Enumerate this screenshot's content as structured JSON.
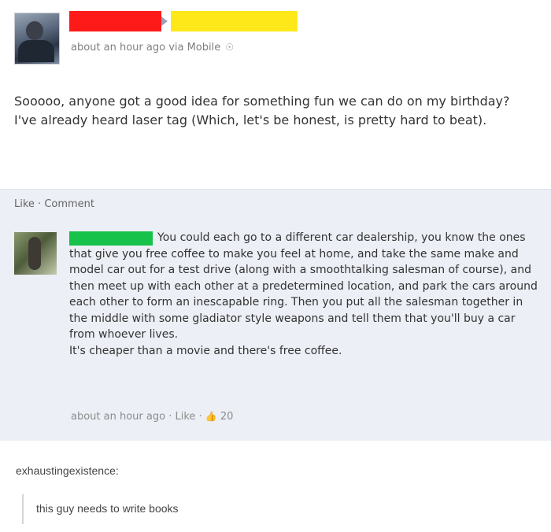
{
  "post": {
    "timestamp": "about an hour ago via Mobile",
    "mobile_icon": "mobile-icon",
    "text": "Sooooo, anyone got a good idea for something fun we can do on my birthday? I've already heard laser tag (Which, let's be honest, is pretty hard to beat).",
    "like_label": "Like",
    "separator": " · ",
    "comment_label": "Comment"
  },
  "redaction_colors": {
    "poster_name": "#ff1a1a",
    "tagged_name": "#ffe81a",
    "commenter_name": "#16c24a"
  },
  "comment": {
    "text": "You could each go to a different car dealership, you know the ones that give you free coffee to make you feel at home, and take the same make and model car out for a test drive (along with a smoothtalking salesman of course), and then meet up with each other at a predetermined location, and park the cars around each other to form an inescapable ring. Then you put all the salesman together in the middle with some gladiator style weapons and tell them that you'll buy a car from whoever lives.",
    "text2": "It's cheaper than a movie and there's free coffee.",
    "timestamp": "about an hour ago",
    "like_label": "Like",
    "like_icon": "thumbs-up-icon",
    "like_count": "20"
  },
  "tumblr": {
    "username": "exhaustingexistence:",
    "reply": "this guy needs to write books"
  }
}
